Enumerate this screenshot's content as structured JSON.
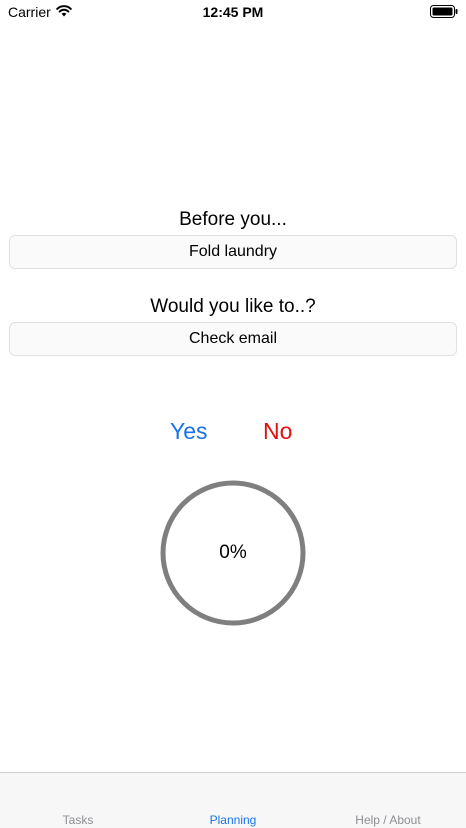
{
  "status_bar": {
    "carrier": "Carrier",
    "time": "12:45 PM",
    "wifi_icon": "wifi-icon",
    "battery_icon": "battery-icon"
  },
  "planning": {
    "before_prompt": "Before you...",
    "before_task": "Fold laundry",
    "would_prompt": "Would you like to..?",
    "would_task": "Check email",
    "yes_label": "Yes",
    "no_label": "No",
    "progress_label": "0%",
    "progress_value": 0,
    "colors": {
      "yes": "#1a73e8",
      "no": "#e01010",
      "ring": "#7f7f7f"
    }
  },
  "tab_bar": {
    "tabs": [
      {
        "label": "Tasks",
        "active": false
      },
      {
        "label": "Planning",
        "active": true
      },
      {
        "label": "Help / About",
        "active": false
      }
    ]
  }
}
